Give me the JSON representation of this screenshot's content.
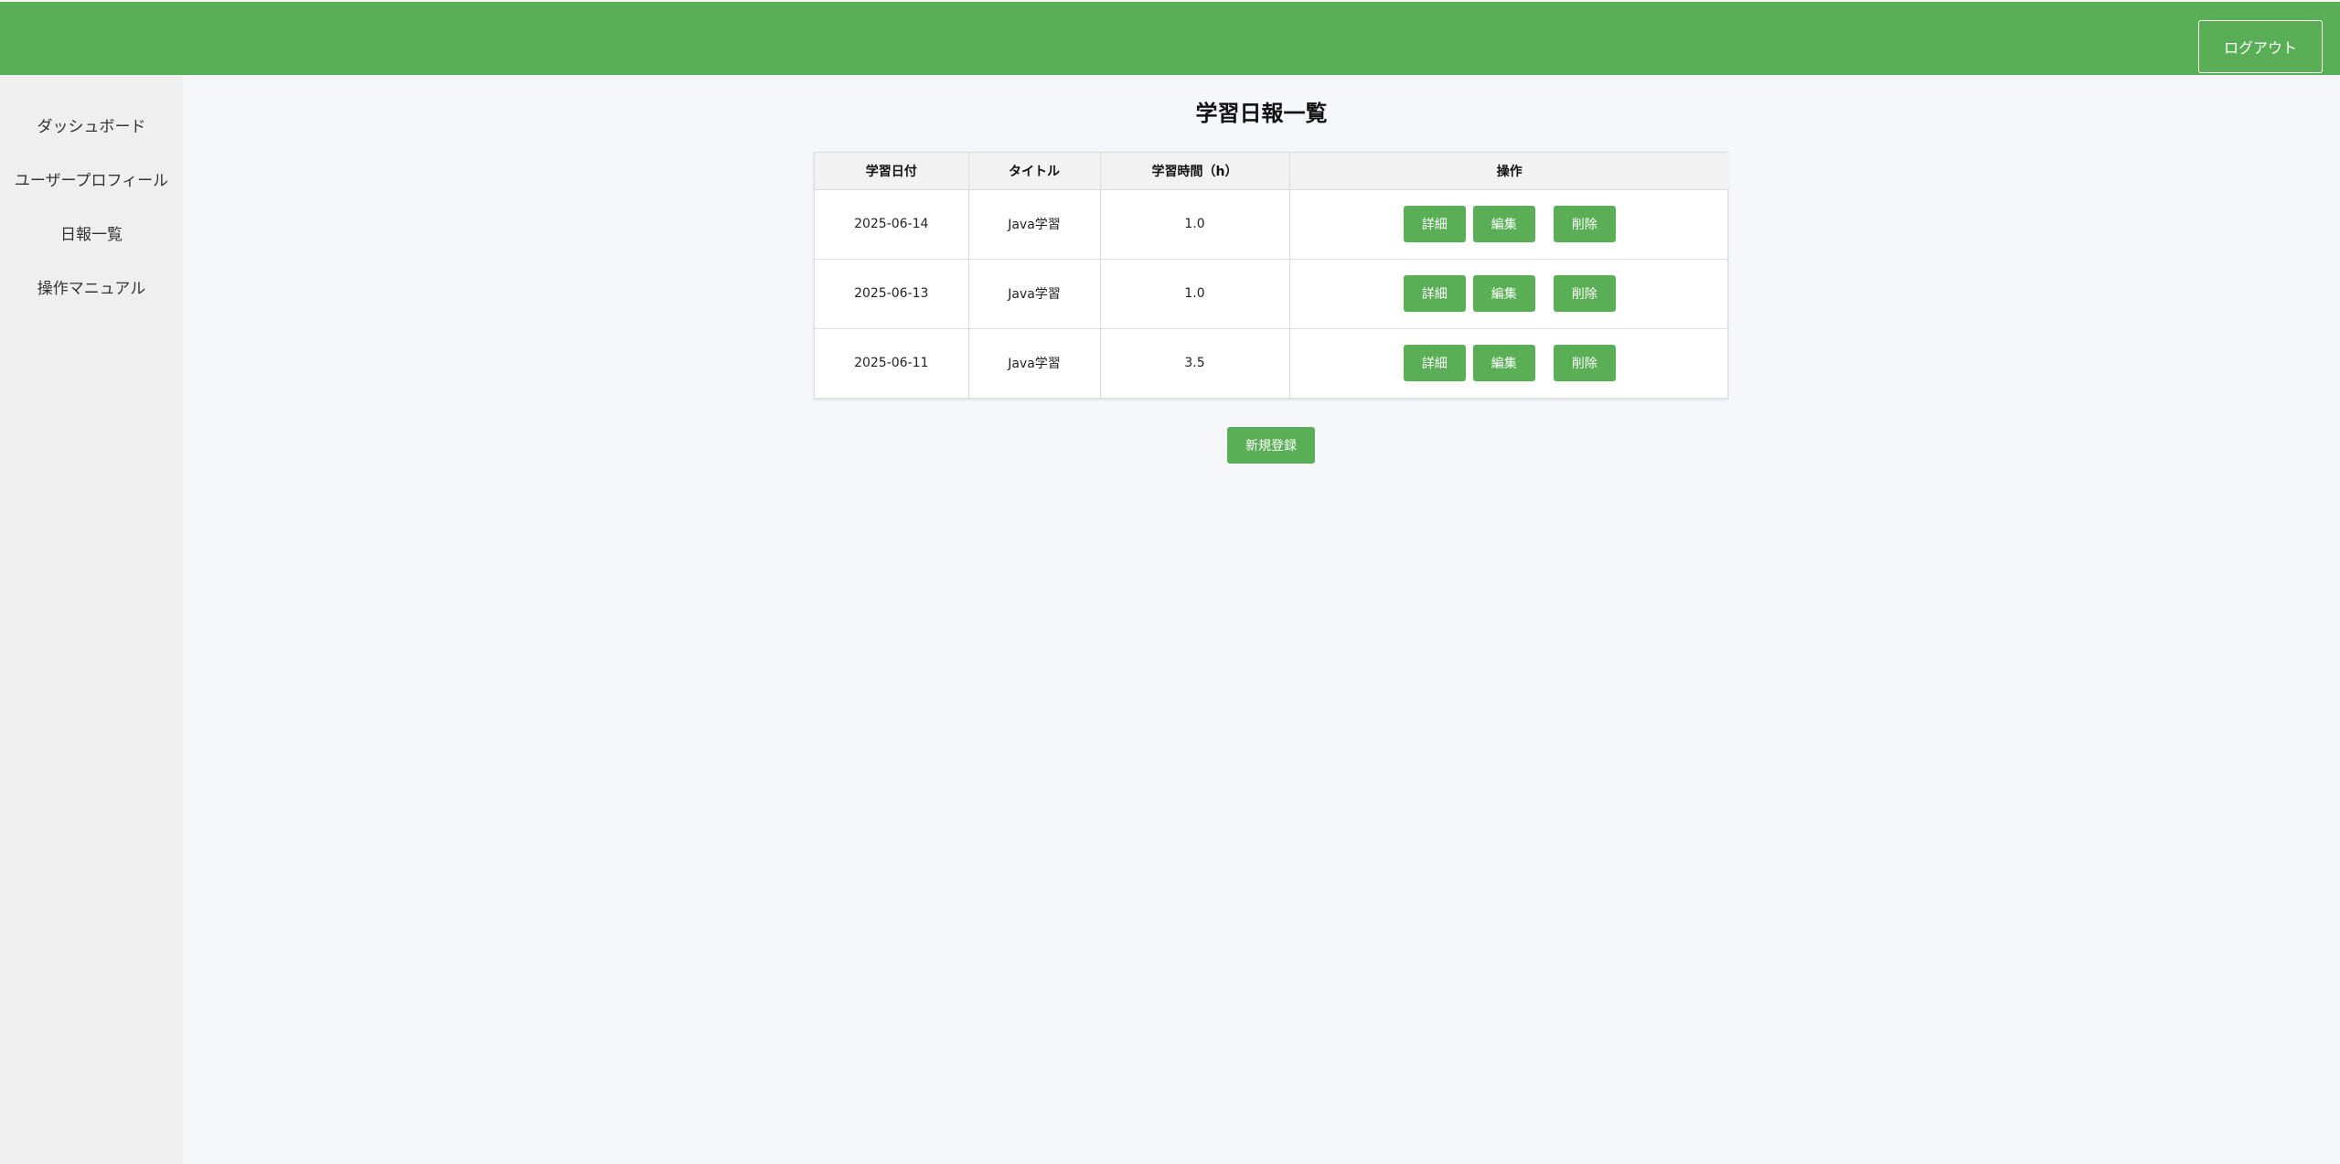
{
  "header": {
    "logout_label": "ログアウト"
  },
  "sidebar": {
    "items": [
      {
        "label": "ダッシュボード"
      },
      {
        "label": "ユーザープロフィール"
      },
      {
        "label": "日報一覧"
      },
      {
        "label": "操作マニュアル"
      }
    ]
  },
  "main": {
    "title": "学習日報一覧",
    "table": {
      "headers": [
        "学習日付",
        "タイトル",
        "学習時間（h）",
        "操作"
      ],
      "rows": [
        {
          "date": "2025-06-14",
          "title": "Java学習",
          "hours": "1.0"
        },
        {
          "date": "2025-06-13",
          "title": "Java学習",
          "hours": "1.0"
        },
        {
          "date": "2025-06-11",
          "title": "Java学習",
          "hours": "3.5"
        }
      ],
      "actions": {
        "detail": "詳細",
        "edit": "編集",
        "delete": "削除"
      }
    },
    "new_label": "新規登録"
  },
  "colors": {
    "accent": "#5aaf56",
    "sidebar_bg": "#efefef",
    "page_bg": "#f5f7fb"
  }
}
